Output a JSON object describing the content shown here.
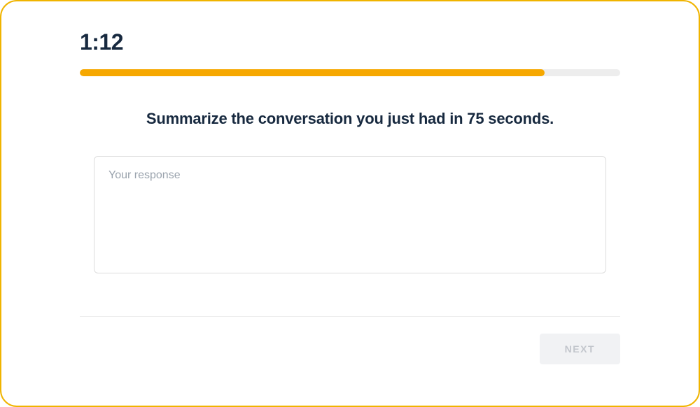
{
  "timer": {
    "display": "1:12"
  },
  "progress": {
    "percent": 86
  },
  "prompt": {
    "text": "Summarize the conversation you just had in 75 seconds."
  },
  "response": {
    "value": "",
    "placeholder": "Your response"
  },
  "footer": {
    "next_label": "NEXT"
  }
}
